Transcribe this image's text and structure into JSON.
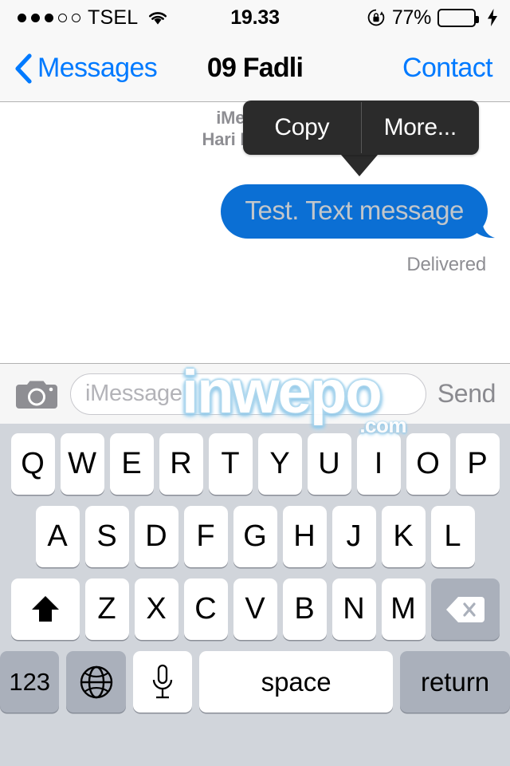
{
  "status_bar": {
    "signal_dots_filled": 3,
    "signal_dots_total": 5,
    "carrier": "TSEL",
    "wifi_icon": "wifi-icon",
    "time": "19.33",
    "rotation_lock_icon": "rotation-lock-icon",
    "battery_percent_label": "77%",
    "battery_level": 77,
    "battery_color": "#4cd964",
    "charging_icon": "lightning-bolt-icon"
  },
  "nav_bar": {
    "back_icon": "chevron-left-icon",
    "back_label": "Messages",
    "title": "09 Fadli",
    "right_action": "Contact",
    "tint_color": "#007aff"
  },
  "conversation": {
    "meta_line1": "iMessage",
    "meta_line2": "Hari Ini 19.33",
    "message": {
      "text": "Test. Text message",
      "status": "Delivered",
      "bubble_color": "#0b6fd4",
      "text_color": "#c2c6ca",
      "side": "outgoing"
    }
  },
  "popup_menu": {
    "items": [
      {
        "label": "Copy"
      },
      {
        "label": "More..."
      }
    ],
    "background_color": "#2b2b2b"
  },
  "input_bar": {
    "camera_icon": "camera-icon",
    "placeholder": "iMessage",
    "value": "",
    "send_label": "Send"
  },
  "watermark": {
    "text": "inwepo",
    "suffix": ".com",
    "accent_color": "#a9d5ed"
  },
  "keyboard": {
    "row1": [
      "Q",
      "W",
      "E",
      "R",
      "T",
      "Y",
      "U",
      "I",
      "O",
      "P"
    ],
    "row2": [
      "A",
      "S",
      "D",
      "F",
      "G",
      "H",
      "J",
      "K",
      "L"
    ],
    "row3": [
      "Z",
      "X",
      "C",
      "V",
      "B",
      "N",
      "M"
    ],
    "shift_icon": "shift-arrow-icon",
    "delete_icon": "backspace-icon",
    "numeric_label": "123",
    "globe_icon": "globe-icon",
    "mic_icon": "microphone-icon",
    "space_label": "space",
    "return_label": "return"
  }
}
